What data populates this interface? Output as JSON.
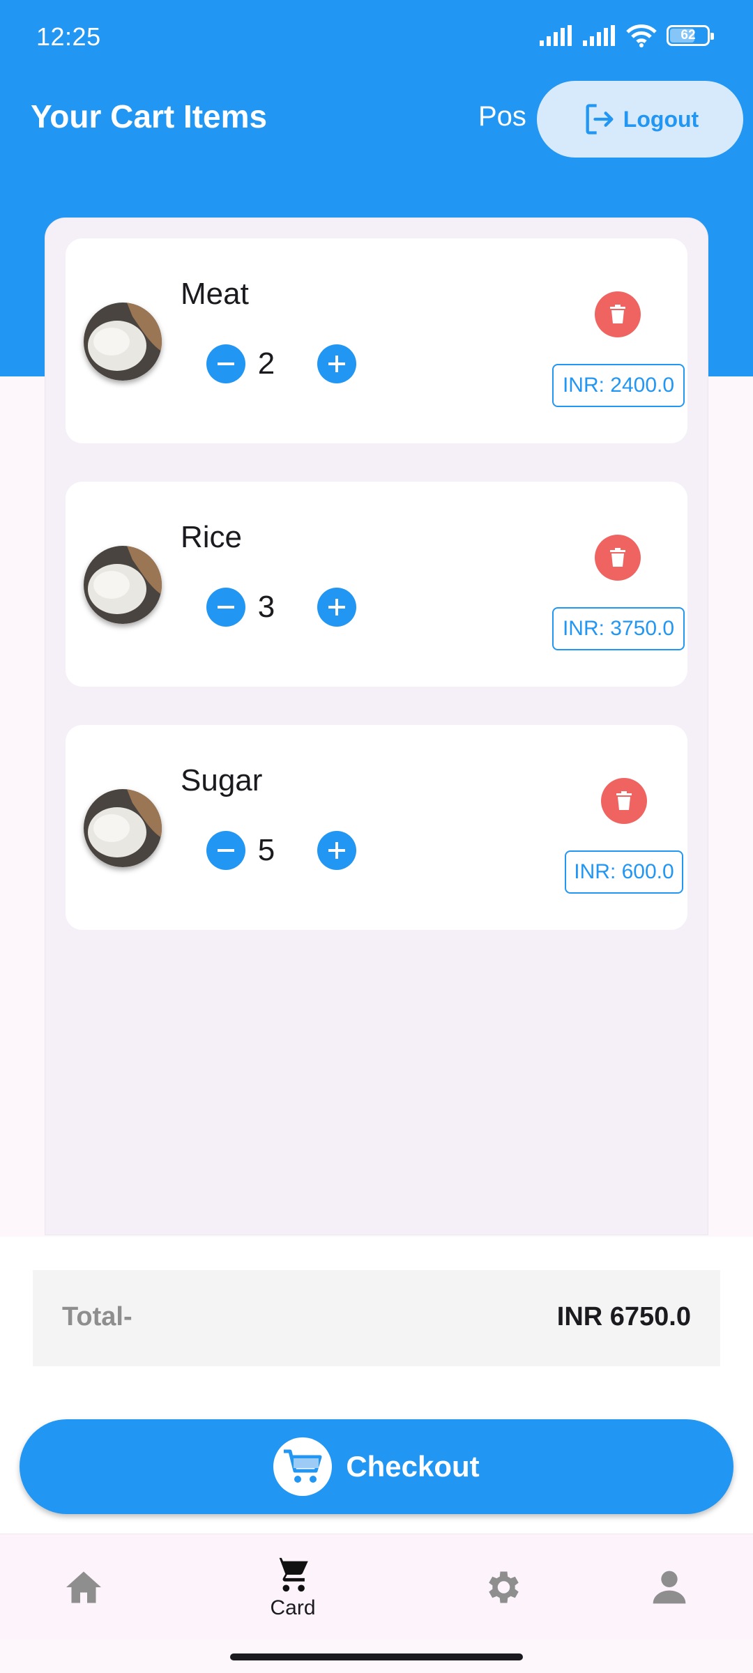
{
  "status_bar": {
    "time": "12:25",
    "battery": "62"
  },
  "app_bar": {
    "title": "Your Cart Items",
    "pos_label": "Pos",
    "logout_label": "Logout"
  },
  "cart": {
    "items": [
      {
        "name": "Meat",
        "quantity": "2",
        "price": "INR: 2400.0"
      },
      {
        "name": "Rice",
        "quantity": "3",
        "price": "INR: 3750.0"
      },
      {
        "name": "Sugar",
        "quantity": "5",
        "price": "INR: 600.0"
      }
    ]
  },
  "summary": {
    "total_label": "Total-",
    "total_value": "INR 6750.0"
  },
  "checkout": {
    "label": "Checkout"
  },
  "bottom_nav": {
    "items": [
      {
        "icon": "home-icon",
        "label": ""
      },
      {
        "icon": "cart-icon",
        "label": "Card"
      },
      {
        "icon": "settings-icon",
        "label": ""
      },
      {
        "icon": "person-icon",
        "label": ""
      }
    ],
    "active_index": 1
  },
  "colors": {
    "primary": "#2196f3",
    "delete": "#ef6461",
    "logout_bg": "#d6eafc",
    "nav_bg": "#fcf3fb"
  }
}
